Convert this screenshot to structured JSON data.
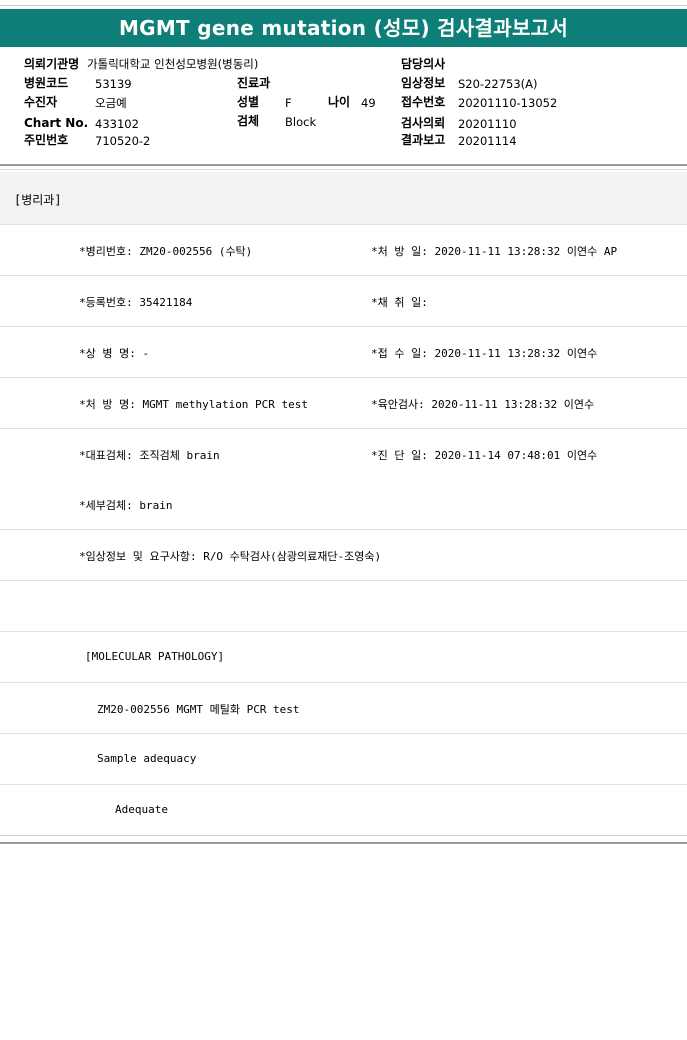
{
  "title": "MGMT gene mutation (성모) 검사결과보고서",
  "header": {
    "institution_label": "의뢰기관명",
    "institution_value": "가톨릭대학교 인천성모병원(병동리)",
    "hospital_code_label": "병원코드",
    "hospital_code_value": "53139",
    "patient_label": "수진자",
    "patient_value": "오금예",
    "chart_label": "Chart No.",
    "chart_value": "433102",
    "resident_label": "주민번호",
    "resident_value": "710520-2",
    "dept_label": "진료과",
    "dept_value": "",
    "sex_label": "성별",
    "sex_value": "F",
    "age_label": "나이",
    "age_value": "49",
    "specimen_label": "검체",
    "specimen_value": "Block",
    "doctor_label": "담당의사",
    "doctor_value": "",
    "clinical_label": "임상정보",
    "clinical_value": "S20-22753(A)",
    "receipt_label": "접수번호",
    "receipt_value": "20201110-13052",
    "request_label": "검사의뢰",
    "request_value": "20201110",
    "report_label": "결과보고",
    "report_value": "20201114"
  },
  "department": "[병리과]",
  "rows": [
    {
      "left": "*병리번호: ZM20-002556 (수탁)",
      "right": "*처 방 일: 2020-11-11 13:28:32  이연수 AP"
    },
    {
      "left": "*등록번호: 35421184",
      "right": "*채 취 일:"
    },
    {
      "left": "*상 병 명: -",
      "right": "*접 수 일: 2020-11-11 13:28:32  이연수"
    },
    {
      "left": "*처 방 명: MGMT methylation  PCR test",
      "right": "*육안검사: 2020-11-11 13:28:32  이연수"
    },
    {
      "left": "*대표검체: 조직검체 brain",
      "right": "*진 단 일: 2020-11-14 07:48:01  이연수"
    },
    {
      "left": "*세부검체: brain",
      "right": ""
    },
    {
      "left": "*임상정보 및 요구사항: R/O 수탁검사(삼광의료재단-조영숙)",
      "right": ""
    },
    {
      "left": "",
      "right": ""
    },
    {
      "left": "[MOLECULAR PATHOLOGY]",
      "right": ""
    },
    {
      "left": "ZM20-002556     MGMT 메틸화  PCR test",
      "right": ""
    },
    {
      "left": "Sample adequacy",
      "right": ""
    },
    {
      "left": "Adequate",
      "right": ""
    }
  ]
}
